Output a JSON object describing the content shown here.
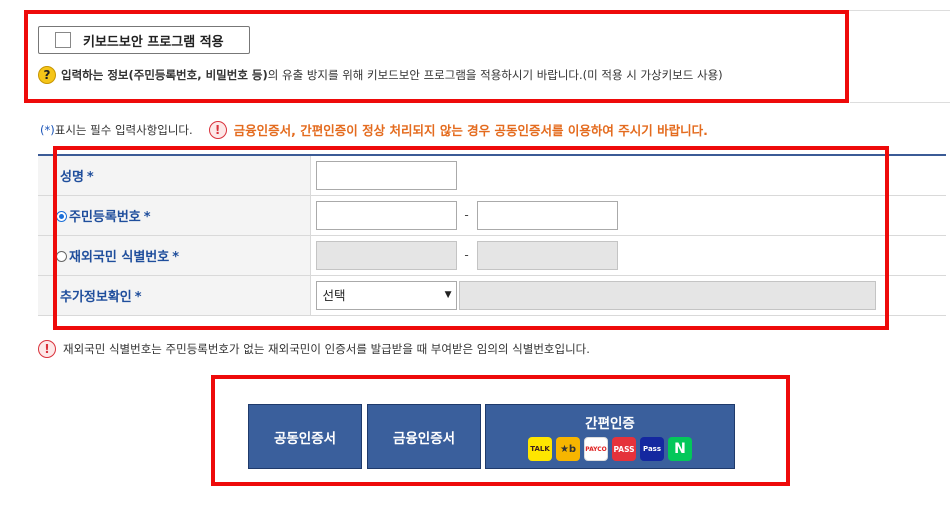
{
  "keyboard_security": {
    "checkbox_label": "키보드보안 프로그램 적용",
    "checked": false,
    "notice_icon": "?",
    "notice_bold": "입력하는 정보",
    "notice_bold2": "(주민등록번호, 비밀번호 등)",
    "notice_rest": "의 유출 방지를 위해 키보드보안 프로그램을 적용하시기 바랍니다.(미 적용 시 가상키보드 사용)"
  },
  "required_note": {
    "star": "(*)",
    "text": " 표시는 필수 입력사항입니다.",
    "alert_icon": "!",
    "warning": "금융인증서, 간편인증이 정상 처리되지 않는 경우 공동인증서를 이용하여 주시기 바랍니다."
  },
  "form": {
    "rows": [
      {
        "label": "성명",
        "star": "*"
      },
      {
        "label": "주민등록번호",
        "star": "*",
        "radio_selected": true,
        "dash": "-"
      },
      {
        "label": "재외국민 식별번호",
        "star": "*",
        "radio_selected": false,
        "dash": "-"
      },
      {
        "label": "추가정보확인",
        "star": "*",
        "select_value": "선택",
        "select_arrow": "▼"
      }
    ]
  },
  "footnote": {
    "icon": "!",
    "text": "재외국민 식별번호는 주민등록번호가 없는 재외국민이 인증서를 발급받을 때 부여받은 임의의 식별번호입니다."
  },
  "buttons": {
    "joint_cert": "공동인증서",
    "financial_cert": "금융인증서",
    "easy_auth": "간편인증",
    "easy_icons": [
      {
        "name": "kakaotalk-icon",
        "text": "TALK"
      },
      {
        "name": "kb-icon",
        "text": "★b"
      },
      {
        "name": "payco-icon",
        "text": "PAYCO"
      },
      {
        "name": "pass-icon",
        "text": "PASS"
      },
      {
        "name": "samsung-pass-icon",
        "text": "Pass"
      },
      {
        "name": "naver-icon",
        "text": "N"
      }
    ]
  },
  "colors": {
    "button_bg": "#3a5f9c",
    "label_text": "#1f4e9c",
    "warning_text": "#e46b1e",
    "highlight_border": "#ee0a0a"
  }
}
